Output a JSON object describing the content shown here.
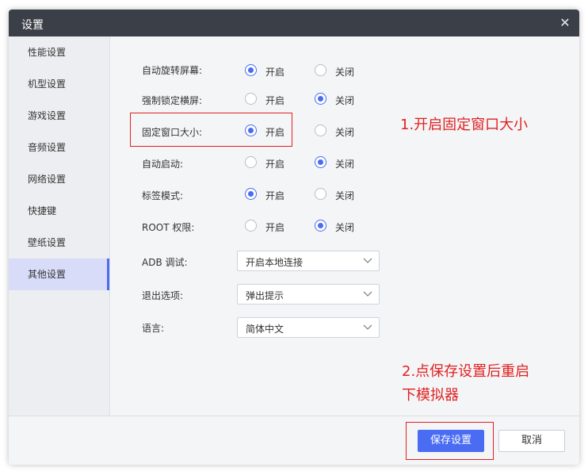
{
  "window": {
    "title": "设置"
  },
  "sidebar": {
    "items": [
      {
        "label": "性能设置"
      },
      {
        "label": "机型设置"
      },
      {
        "label": "游戏设置"
      },
      {
        "label": "音频设置"
      },
      {
        "label": "网络设置"
      },
      {
        "label": "快捷键"
      },
      {
        "label": "壁纸设置"
      },
      {
        "label": "其他设置",
        "active": true
      }
    ]
  },
  "settings": {
    "on_label": "开启",
    "off_label": "关闭",
    "rows": [
      {
        "label": "自动旋转屏幕:",
        "value": "on"
      },
      {
        "label": "强制锁定横屏:",
        "value": "off"
      },
      {
        "label": "固定窗口大小:",
        "value": "on"
      },
      {
        "label": "自动启动:",
        "value": "off"
      },
      {
        "label": "标签模式:",
        "value": "on"
      },
      {
        "label": "ROOT 权限:",
        "value": "off"
      }
    ],
    "selects": [
      {
        "label": "ADB 调试:",
        "value": "开启本地连接"
      },
      {
        "label": "退出选项:",
        "value": "弹出提示"
      },
      {
        "label": "语言:",
        "value": "简体中文"
      }
    ]
  },
  "annotations": {
    "step1": "1.开启固定窗口大小",
    "step2_line1": "2.点保存设置后重启",
    "step2_line2": "下模拟器",
    "color": "#e02020"
  },
  "footer": {
    "save_label": "保存设置",
    "cancel_label": "取消"
  },
  "colors": {
    "accent": "#4a6cf2",
    "titlebar": "#3b3f47"
  }
}
